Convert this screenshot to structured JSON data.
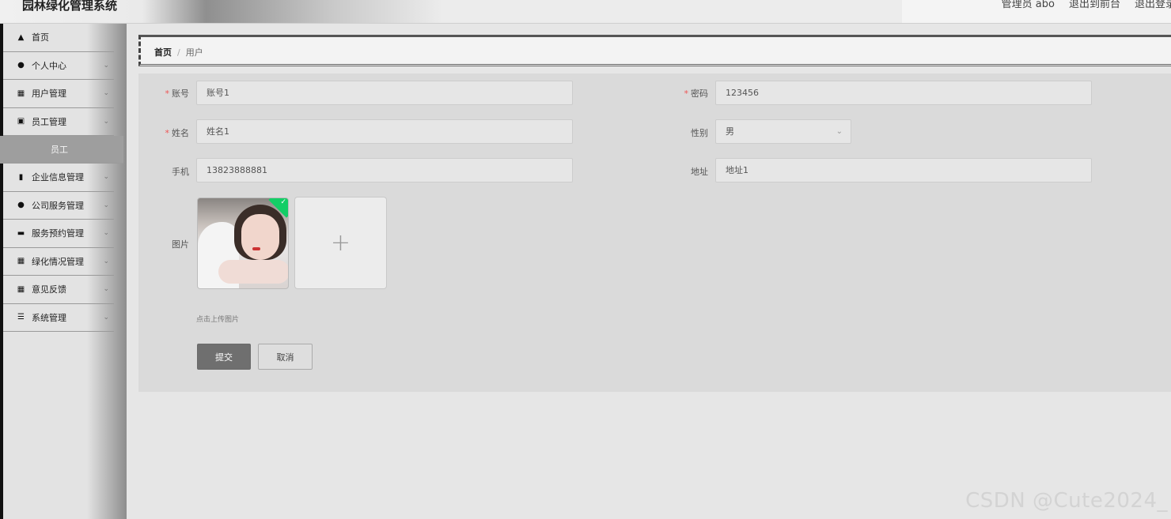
{
  "header": {
    "app_title": "园林绿化管理系统",
    "links": [
      "管理员 abo",
      "退出到前台",
      "退出登录"
    ]
  },
  "sidebar": {
    "items": [
      {
        "label": "首页",
        "icon": "home-icon",
        "expandable": false
      },
      {
        "label": "个人中心",
        "icon": "user-icon",
        "expandable": true
      },
      {
        "label": "用户管理",
        "icon": "grid-icon",
        "expandable": true
      },
      {
        "label": "员工管理",
        "icon": "briefcase-icon",
        "expandable": true
      },
      {
        "label": "企业信息管理",
        "icon": "clipboard-icon",
        "expandable": true
      },
      {
        "label": "公司服务管理",
        "icon": "location-pin-icon",
        "expandable": true
      },
      {
        "label": "服务预约管理",
        "icon": "monitor-icon",
        "expandable": true
      },
      {
        "label": "绿化情况管理",
        "icon": "grid-icon",
        "expandable": true
      },
      {
        "label": "意见反馈",
        "icon": "grid-icon",
        "expandable": true
      },
      {
        "label": "系统管理",
        "icon": "list-icon",
        "expandable": true
      }
    ],
    "active_submenu": "员工"
  },
  "breadcrumb": {
    "home": "首页",
    "separator": "/",
    "current": "用户"
  },
  "form": {
    "account": {
      "label": "账号",
      "required": true,
      "value": "账号1"
    },
    "password": {
      "label": "密码",
      "required": true,
      "value": "123456"
    },
    "name": {
      "label": "姓名",
      "required": true,
      "value": "姓名1"
    },
    "gender": {
      "label": "性别",
      "required": false,
      "value": "男"
    },
    "phone": {
      "label": "手机",
      "required": false,
      "value": "13823888881"
    },
    "address": {
      "label": "地址",
      "required": false,
      "value": "地址1"
    },
    "picture": {
      "label": "图片",
      "hint": "点击上传图片",
      "uploaded": true
    },
    "submit_label": "提交",
    "cancel_label": "取消"
  },
  "watermark": "CSDN @Cute2024_",
  "colors": {
    "required_star": "#e55555",
    "upload_success": "#13ce66",
    "primary_button": "#6f6f6f"
  }
}
